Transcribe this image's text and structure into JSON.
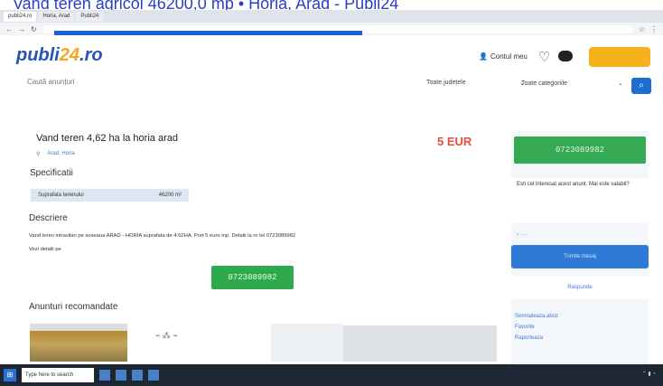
{
  "window": {
    "title": "Vand teren agricol 46200,0 mp • Horia, Arad - Publi24"
  },
  "browser": {
    "tabs": [
      "publi24.ro",
      "Horia, Arad",
      "Publi24"
    ],
    "progress": 0.55
  },
  "header": {
    "logo_main": "publi",
    "logo_accent": "24",
    "logo_tld": ".ro",
    "account_label": "Contul meu"
  },
  "search": {
    "placeholder": "Caută anunțuri",
    "location": "Toate județele",
    "category": "Toate categoriile"
  },
  "ad": {
    "title": "Vand teren 4,62 ha la horia arad",
    "meta_location": "Arad, Horia",
    "price": "5 EUR",
    "spec_title": "Specificatii",
    "spec_label": "Suprafata terenului",
    "spec_value": "46200 m²",
    "desc_title": "Descriere",
    "description": "Vand teren intravilan pe soseaua ARAD - HORIA suprafata de 4.62HA. Pret 5 euro mp. Detalii la nr tel 0723089982",
    "desc_link_prefix": "Vezi detalii pe",
    "phone": "0723089982",
    "recommended_title": "Anunturi recomandate"
  },
  "sidebar": {
    "phone": "0723089982",
    "question": "Esti cel interesat acest anunt. Mai este valabil?",
    "contact_label": "Trimite mesaj",
    "reply_label": "Raspunde",
    "links": [
      "Semnaleaza abuz",
      "Favorite",
      "Raporteaza"
    ]
  },
  "taskbar": {
    "search_placeholder": "Type here to search"
  }
}
